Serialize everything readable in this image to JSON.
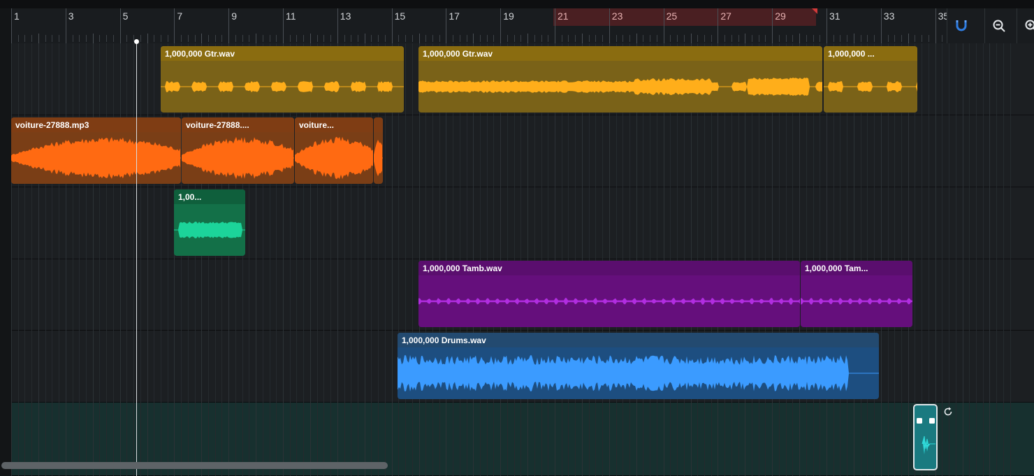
{
  "colors": {
    "guitar": {
      "header": "#8a6c10",
      "body": "#7a6218",
      "wave": "#ffae1a"
    },
    "voiture": {
      "header": "#7f3d14",
      "body": "#7a3e16",
      "wave": "#ff6a12"
    },
    "green": {
      "header": "#0f5f3c",
      "body": "#137048",
      "wave": "#1cd49a"
    },
    "tamb": {
      "header": "#5a0e6e",
      "body": "#650f7c",
      "wave": "#b12de0"
    },
    "drums": {
      "header": "#234a70",
      "body": "#1d4e80",
      "wave": "#3b9bff"
    },
    "accent": "#2f7de2",
    "loop_region": "#4a1f22",
    "loop_marker": "#d23a3a"
  },
  "ruler": {
    "bar_numbers": [
      "1",
      "3",
      "5",
      "7",
      "9",
      "11",
      "13",
      "15",
      "17",
      "19",
      "21",
      "23",
      "25",
      "27",
      "29",
      "31",
      "33",
      "35"
    ],
    "loop_bars": [
      "21",
      "23",
      "25",
      "27",
      "29"
    ]
  },
  "toolbar": {
    "snap_icon": "magnet-icon",
    "zoom_out_icon": "zoom-out-icon",
    "zoom_in_icon": "zoom-in-icon"
  },
  "tracks": [
    {
      "name": "guitar-track",
      "color": "guitar",
      "clips": [
        {
          "label": "1,000,000 Gtr.wav"
        },
        {
          "label": "1,000,000 Gtr.wav"
        },
        {
          "label": "1,000,000 ..."
        }
      ]
    },
    {
      "name": "voiture-track",
      "color": "voiture",
      "clips": [
        {
          "label": "voiture-27888.mp3"
        },
        {
          "label": "voiture-27888...."
        },
        {
          "label": "voiture..."
        },
        {
          "label": ""
        }
      ]
    },
    {
      "name": "green-track",
      "color": "green",
      "clips": [
        {
          "label": "1,00..."
        }
      ]
    },
    {
      "name": "tamb-track",
      "color": "tamb",
      "clips": [
        {
          "label": "1,000,000 Tamb.wav"
        },
        {
          "label": "1,000,000 Tam..."
        }
      ]
    },
    {
      "name": "drums-track",
      "color": "drums",
      "clips": [
        {
          "label": "1,000,000 Drums.wav"
        }
      ]
    },
    {
      "name": "sampler-track",
      "color": "none",
      "clips": []
    }
  ],
  "sampler": {
    "icon": "sampler-pad-icon",
    "loop_icon": "loop-refresh-icon"
  }
}
